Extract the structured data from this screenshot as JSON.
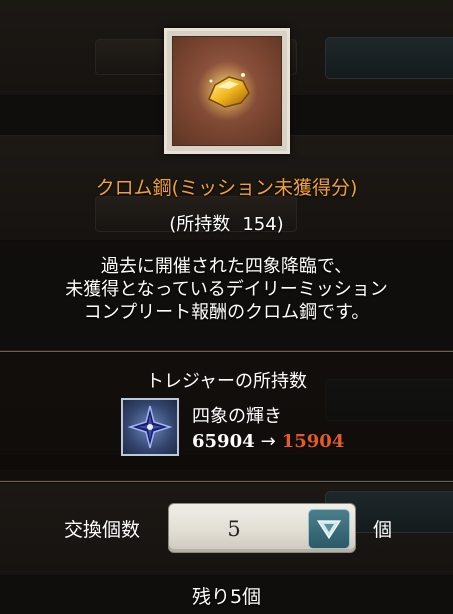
{
  "item": {
    "name": "クロム鋼(ミッション未獲得分)",
    "owned_label": "(所持数",
    "owned_value": "154)",
    "description_lines": [
      "過去に開催された四象降臨で、",
      "未獲得となっているデイリーミッション",
      "コンプリート報酬のクロム鋼です。"
    ],
    "icon": "chrome-steel-nugget-icon"
  },
  "treasure": {
    "title": "トレジャーの所持数",
    "name": "四象の輝き",
    "before": "65904",
    "arrow": "→",
    "after": "15904",
    "icon": "four-symbols-radiance-icon"
  },
  "exchange": {
    "qty_label": "交換個数",
    "qty_value": "5",
    "unit": "個",
    "remaining": "残り5個",
    "dropdown_icon": "chevron-down-icon"
  },
  "colors": {
    "item_name": "#f0a13a",
    "after_count": "#e35a2b",
    "stepper_button": "#2c5a66"
  }
}
